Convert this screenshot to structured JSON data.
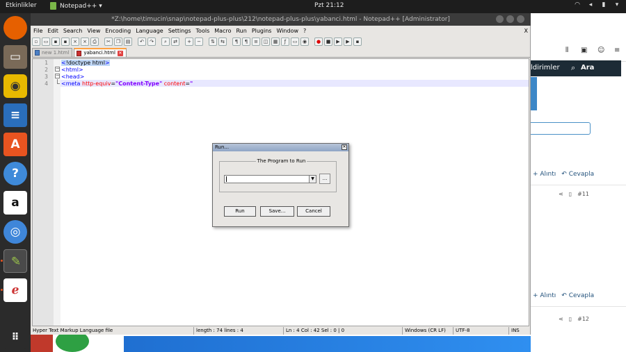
{
  "topbar": {
    "activities": "Etkinlikler",
    "app_name": "Notepad++ ▾",
    "clock": "Pzt 21:12",
    "tray_icons": [
      "wifi-icon",
      "volume-icon",
      "battery-icon",
      "power-menu-icon"
    ]
  },
  "dock": {
    "items": [
      {
        "name": "firefox",
        "color": "#e66000"
      },
      {
        "name": "files",
        "color": "#7a6a58"
      },
      {
        "name": "rhythmbox",
        "color": "#e8b900"
      },
      {
        "name": "libreoffice-writer",
        "color": "#2a6ebb"
      },
      {
        "name": "ubuntu-software",
        "color": "#e95420"
      },
      {
        "name": "help",
        "color": "#3f8ad9"
      },
      {
        "name": "amazon",
        "color": "#ffffff"
      },
      {
        "name": "chromium",
        "color": "#3f86d9"
      },
      {
        "name": "notepad-plus-plus",
        "color": "#9bc44a"
      },
      {
        "name": "evince",
        "color": "#ffffff"
      },
      {
        "name": "show-applications",
        "color": "#2b2b2b"
      }
    ]
  },
  "npp": {
    "title": "*Z:\\home\\timucin\\snap\\notepad-plus-plus\\212\\notepad-plus-plus\\yabanci.html - Notepad++ [Administrator]",
    "menu": [
      "File",
      "Edit",
      "Search",
      "View",
      "Encoding",
      "Language",
      "Settings",
      "Tools",
      "Macro",
      "Run",
      "Plugins",
      "Window",
      "?"
    ],
    "menu_close": "X",
    "tabs": [
      {
        "label": "new 1.html",
        "active": false
      },
      {
        "label": "yabanci.html",
        "active": true
      }
    ],
    "lines": [
      {
        "num": "1",
        "parts": [
          {
            "cls": "tag hl",
            "text": "<"
          },
          {
            "cls": "txt hl",
            "text": "!doctype html"
          },
          {
            "cls": "tag hl",
            "text": ">"
          }
        ]
      },
      {
        "num": "2",
        "parts": [
          {
            "cls": "tag",
            "text": "<html>"
          }
        ]
      },
      {
        "num": "3",
        "parts": [
          {
            "cls": "tag",
            "text": "<head>"
          }
        ]
      },
      {
        "num": "4",
        "parts": [
          {
            "cls": "tag",
            "text": "<meta "
          },
          {
            "cls": "attr",
            "text": "http-equiv"
          },
          {
            "cls": "txt",
            "text": "="
          },
          {
            "cls": "val",
            "text": "\"Content-Type\""
          },
          {
            "cls": "attr",
            "text": " content"
          },
          {
            "cls": "txt",
            "text": "="
          },
          {
            "cls": "val",
            "text": "\""
          }
        ]
      }
    ],
    "status": {
      "filetype": "Hyper Text Markup Language file",
      "length": "length : 74    lines : 4",
      "position": "Ln : 4    Col : 42    Sel : 0 | 0",
      "eol": "Windows (CR LF)",
      "encoding": "UTF-8",
      "mode": "INS"
    }
  },
  "run_dialog": {
    "title": "Run...",
    "group_label": "The Program to Run",
    "combo_value": "",
    "browse_label": "...",
    "buttons": {
      "run": "Run",
      "save": "Save...",
      "cancel": "Cancel"
    }
  },
  "browser": {
    "nav_text": "ldirimler",
    "search_label": "Ara",
    "posts": [
      {
        "quote": "+ Alıntı",
        "reply": "Cevapla",
        "number": "#11"
      },
      {
        "quote": "+ Alıntı",
        "reply": "Cevapla",
        "number": "#12"
      }
    ]
  }
}
